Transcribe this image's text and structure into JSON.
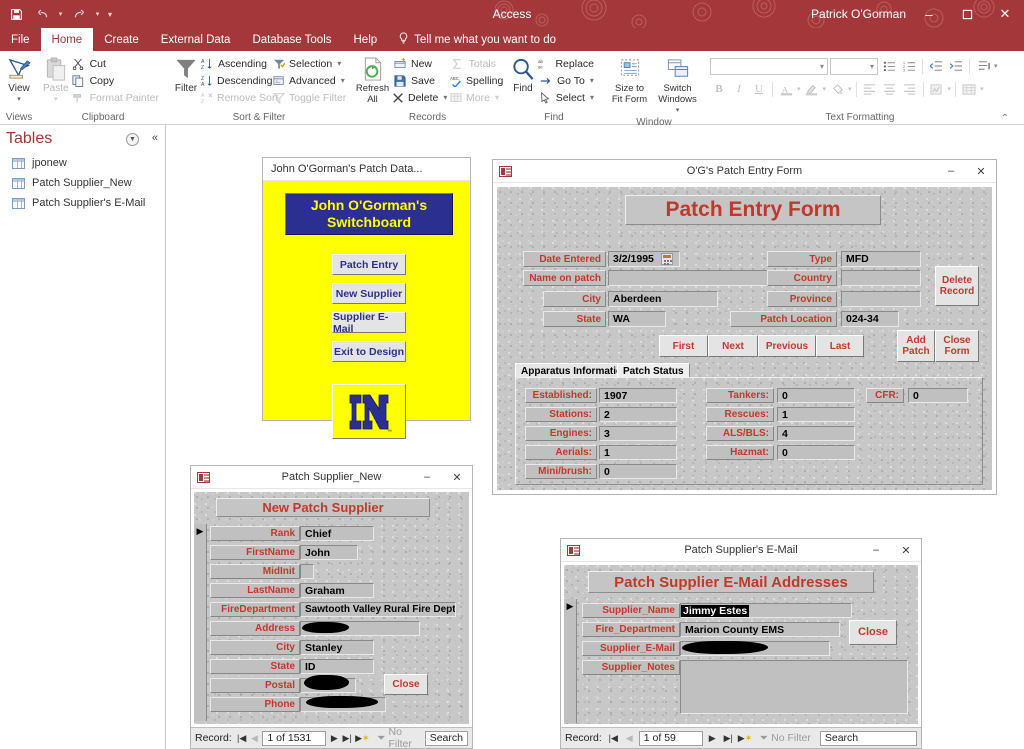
{
  "titlebar": {
    "app_title": "Access",
    "user_name": "Patrick O'Gorman",
    "qat": {
      "save": "save-icon",
      "undo": "undo-icon",
      "redo": "redo-icon",
      "customize": "customize-qat-icon"
    },
    "window_buttons": {
      "minimize": "–",
      "maximize": "☐",
      "close": "✕"
    }
  },
  "ribbon": {
    "tabs": [
      {
        "label": "File",
        "active": false
      },
      {
        "label": "Home",
        "active": true
      },
      {
        "label": "Create",
        "active": false
      },
      {
        "label": "External Data",
        "active": false
      },
      {
        "label": "Database Tools",
        "active": false
      },
      {
        "label": "Help",
        "active": false
      }
    ],
    "tell_me": "Tell me what you want to do",
    "groups": [
      {
        "name": "Views",
        "label": "Views",
        "big": [
          {
            "caption": "View",
            "icon": "design-view-icon",
            "disabled": false,
            "has_caret": true
          }
        ]
      },
      {
        "name": "Clipboard",
        "label": "Clipboard",
        "big": [
          {
            "caption": "Paste",
            "icon": "paste-icon",
            "disabled": true,
            "has_caret": true
          }
        ],
        "small": [
          {
            "label": "Cut",
            "icon": "scissors-icon",
            "disabled": false
          },
          {
            "label": "Copy",
            "icon": "copy-icon",
            "disabled": false
          },
          {
            "label": "Format Painter",
            "icon": "format-painter-icon",
            "disabled": true
          }
        ],
        "launcher": true
      },
      {
        "name": "Sort & Filter",
        "label": "Sort & Filter",
        "big": [
          {
            "caption": "Filter",
            "icon": "funnel-icon",
            "disabled": false,
            "has_caret": false
          }
        ],
        "small": [
          {
            "label": "Ascending",
            "icon": "sort-ascending-icon",
            "disabled": false
          },
          {
            "label": "Descending",
            "icon": "sort-descending-icon",
            "disabled": false
          },
          {
            "label": "Remove Sort",
            "icon": "remove-sort-icon",
            "disabled": true
          }
        ],
        "small2": [
          {
            "label": "Selection",
            "icon": "selection-filter-icon",
            "disabled": false,
            "caret": true
          },
          {
            "label": "Advanced",
            "icon": "advanced-filter-icon",
            "disabled": false,
            "caret": true
          },
          {
            "label": "Toggle Filter",
            "icon": "toggle-filter-icon",
            "disabled": true
          }
        ]
      },
      {
        "name": "Records",
        "label": "Records",
        "big": [
          {
            "caption": "Refresh\nAll",
            "icon": "refresh-all-icon",
            "disabled": false,
            "has_caret": true
          }
        ],
        "small": [
          {
            "label": "New",
            "icon": "new-record-icon",
            "disabled": false
          },
          {
            "label": "Save",
            "icon": "save-record-icon",
            "disabled": false
          },
          {
            "label": "Delete",
            "icon": "delete-record-icon",
            "disabled": false,
            "caret": true
          }
        ],
        "small2": [
          {
            "label": "Totals",
            "icon": "sigma-totals-icon",
            "disabled": true
          },
          {
            "label": "Spelling",
            "icon": "spelling-icon",
            "disabled": false
          },
          {
            "label": "More",
            "icon": "more-records-icon",
            "disabled": true,
            "caret": true
          }
        ]
      },
      {
        "name": "Find",
        "label": "Find",
        "big": [
          {
            "caption": "Find",
            "icon": "magnifier-icon",
            "disabled": false,
            "has_caret": false
          }
        ],
        "small": [
          {
            "label": "Replace",
            "icon": "replace-icon",
            "disabled": false
          },
          {
            "label": "Go To",
            "icon": "go-to-icon",
            "disabled": false,
            "caret": true
          },
          {
            "label": "Select",
            "icon": "select-icon",
            "disabled": false,
            "caret": true
          }
        ]
      },
      {
        "name": "Window",
        "label": "Window",
        "big": [
          {
            "caption": "Size to\nFit Form",
            "icon": "size-to-fit-form-icon",
            "disabled": false,
            "has_caret": false
          },
          {
            "caption": "Switch\nWindows",
            "icon": "switch-windows-icon",
            "disabled": false,
            "has_caret": true
          }
        ]
      },
      {
        "name": "Text Formatting",
        "label": "Text Formatting",
        "font_name": "",
        "font_size": "",
        "buttons": [
          "bullets-icon",
          "numbering-icon",
          "decrease-indent-icon",
          "increase-indent-icon",
          "rtl-ltr-icon",
          "bold-icon",
          "italic-icon",
          "underline-icon",
          "font-color-icon",
          "text-highlight-icon",
          "fill-color-icon",
          "align-left-icon",
          "align-center-icon",
          "align-right-icon",
          "conditional-formatting-icon",
          "gridlines-icon"
        ],
        "launcher": true
      }
    ],
    "collapse": "collapse-ribbon-icon"
  },
  "navpane": {
    "title": "Tables",
    "dropdown_icon": "shutter-bar-dropdown-icon",
    "collapse_icon": "collapse-navpane-icon",
    "items": [
      {
        "label": "jponew",
        "icon": "table-icon"
      },
      {
        "label": "Patch Supplier_New",
        "icon": "table-icon"
      },
      {
        "label": "Patch Supplier's E-Mail",
        "icon": "table-icon"
      }
    ]
  },
  "switchboard": {
    "window_title": "John O'Gorman's Patch Data...",
    "banner": "John O'Gorman's\nSwitchboard",
    "buttons": [
      {
        "label": "Patch Entry"
      },
      {
        "label": "New Supplier"
      },
      {
        "label": "Supplier E-Mail"
      },
      {
        "label": "Exit to Design"
      }
    ],
    "logo": {
      "name": "notre-dame-nd-logo",
      "text": "ND",
      "trademark": "™"
    },
    "colors": {
      "background": "#ffff00",
      "banner_bg": "#2b2f8f",
      "banner_text": "#ffff00",
      "button_text": "#2b2f8f"
    }
  },
  "patch_entry": {
    "window_title": "O'G's Patch Entry Form",
    "window_icon": "form-icon",
    "minimize": "–",
    "close": "✕",
    "heading": "Patch Entry Form",
    "left_fields": [
      {
        "label": "Date Entered",
        "value": "3/2/1995",
        "has_calendar": true
      },
      {
        "label": "Name on patch",
        "value": ""
      },
      {
        "label": "City",
        "value": "Aberdeen"
      },
      {
        "label": "State",
        "value": "WA"
      }
    ],
    "right_fields": [
      {
        "label": "Type",
        "value": "MFD",
        "is_combo": true
      },
      {
        "label": "Country",
        "value": ""
      },
      {
        "label": "Province",
        "value": ""
      },
      {
        "label": "Patch Location",
        "value": "024-34"
      }
    ],
    "delete_button": "Delete\nRecord",
    "nav_buttons": [
      {
        "label": "First"
      },
      {
        "label": "Next"
      },
      {
        "label": "Previous"
      },
      {
        "label": "Last"
      }
    ],
    "action_buttons": [
      {
        "label": "Add\nPatch"
      },
      {
        "label": "Close\nForm"
      }
    ],
    "tabs": [
      {
        "label": "Apparatus Information",
        "active": true
      },
      {
        "label": "Patch Status",
        "active": false
      }
    ],
    "apparatus": {
      "col1": [
        {
          "label": "Established:",
          "value": "1907"
        },
        {
          "label": "Stations:",
          "value": "2"
        },
        {
          "label": "Engines:",
          "value": "3"
        },
        {
          "label": "Aerials:",
          "value": "1"
        },
        {
          "label": "Mini/brush:",
          "value": "0"
        }
      ],
      "col2": [
        {
          "label": "Tankers:",
          "value": "0"
        },
        {
          "label": "Rescues:",
          "value": "1"
        },
        {
          "label": "ALS/BLS:",
          "value": "4"
        },
        {
          "label": "Hazmat:",
          "value": "0"
        }
      ],
      "col3": [
        {
          "label": "CFR:",
          "value": "0"
        }
      ]
    }
  },
  "supplier_new": {
    "window_title": "Patch Supplier_New",
    "window_icon": "form-icon",
    "minimize": "–",
    "close": "✕",
    "heading": "New Patch Supplier",
    "record_selector": "▶",
    "fields": [
      {
        "label": "Rank",
        "value": "Chief",
        "redacted": false
      },
      {
        "label": "FirstName",
        "value": "John",
        "redacted": false
      },
      {
        "label": "MidInit",
        "value": "",
        "redacted": false
      },
      {
        "label": "LastName",
        "value": "Graham",
        "redacted": false
      },
      {
        "label": "FireDepartment",
        "value": "Sawtooth Valley Rural Fire Dept.",
        "redacted": false
      },
      {
        "label": "Address",
        "value": "",
        "redacted": true
      },
      {
        "label": "City",
        "value": "Stanley",
        "redacted": false
      },
      {
        "label": "State",
        "value": "ID",
        "redacted": false
      },
      {
        "label": "Postal",
        "value": "",
        "redacted": true
      },
      {
        "label": "Phone",
        "value": "",
        "redacted": true
      }
    ],
    "close_button": "Close",
    "navigator": {
      "label": "Record:",
      "count": "1 of 1531",
      "filter": "No Filter",
      "search": "Search",
      "first_icon": "nav-first-icon",
      "prev_icon": "nav-prev-icon",
      "next_icon": "nav-next-icon",
      "last_icon": "nav-last-icon",
      "new_icon": "nav-new-record-icon",
      "filter_icon": "filter-funnel-icon"
    }
  },
  "supplier_email": {
    "window_title": "Patch Supplier's E-Mail",
    "window_icon": "form-icon",
    "minimize": "–",
    "close": "✕",
    "heading": "Patch Supplier E-Mail Addresses",
    "record_selector": "▶",
    "fields": [
      {
        "label": "Supplier_Name",
        "value": "Jimmy Estes",
        "selected": true,
        "redacted": false
      },
      {
        "label": "Fire_Department",
        "value": "Marion County EMS",
        "selected": false,
        "redacted": false
      },
      {
        "label": "Supplier_E-Mail",
        "value": "",
        "selected": false,
        "redacted": true
      },
      {
        "label": "Supplier_Notes",
        "value": "",
        "selected": false,
        "redacted": false
      }
    ],
    "close_button": "Close",
    "navigator": {
      "label": "Record:",
      "count": "1 of 59",
      "filter": "No Filter",
      "search": "Search",
      "first_icon": "nav-first-icon",
      "prev_icon": "nav-prev-icon",
      "next_icon": "nav-next-icon",
      "last_icon": "nav-last-icon",
      "new_icon": "nav-new-record-icon",
      "filter_icon": "filter-funnel-icon"
    }
  },
  "colors": {
    "accent": "#a4373a",
    "form_label_text": "#c0392b",
    "switchboard_bg": "#ffff00",
    "switchboard_banner": "#2b2f8f"
  }
}
